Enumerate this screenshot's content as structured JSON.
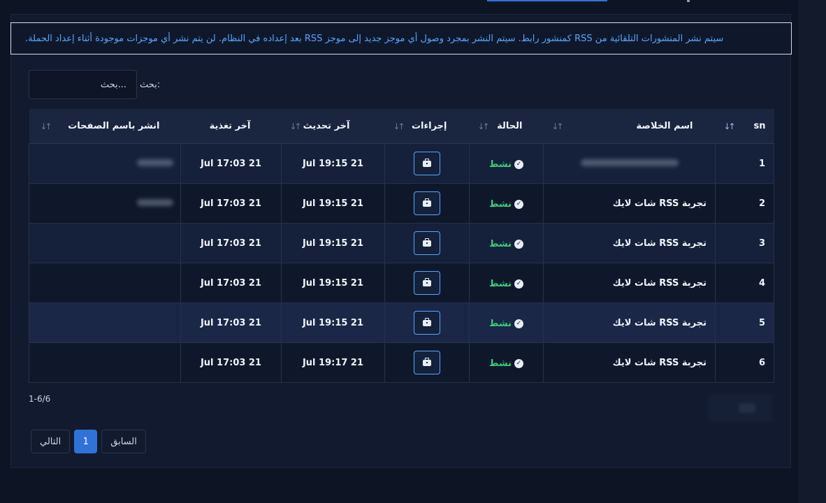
{
  "notice": "سيتم نشر المنشورات التلقائية من RSS كمنشور رابط. سيتم النشر بمجرد وصول أي موجز جديد إلى موجز RSS بعد إعداده في النظام. لن يتم نشر أي موجزات موجودة أثناء إعداد الحملة.",
  "search": {
    "label": "بحث:",
    "placeholder": "بحث..."
  },
  "table": {
    "headers": {
      "sn": "sn",
      "feed_name": "اسم الخلاصة",
      "status": "الحالة",
      "actions": "إجراءات",
      "last_update": "آخر تحديث",
      "last_feed": "آخر تغذية",
      "publish_as": "انشر باسم الصفحات"
    },
    "rows": [
      {
        "sn": "1",
        "feed_name": "",
        "status": "نشط",
        "last_update": "Jul 19:15 21",
        "last_feed": "Jul 17:03 21",
        "publish_as": ""
      },
      {
        "sn": "2",
        "feed_name": "تجربة RSS شات لايك",
        "status": "نشط",
        "last_update": "Jul 19:15 21",
        "last_feed": "Jul 17:03 21",
        "publish_as": ""
      },
      {
        "sn": "3",
        "feed_name": "تجربة RSS شات لايك",
        "status": "نشط",
        "last_update": "Jul 19:15 21",
        "last_feed": "Jul 17:03 21",
        "publish_as": ""
      },
      {
        "sn": "4",
        "feed_name": "تجربة RSS شات لايك",
        "status": "نشط",
        "last_update": "Jul 19:15 21",
        "last_feed": "Jul 17:03 21",
        "publish_as": ""
      },
      {
        "sn": "5",
        "feed_name": "تجربة RSS شات لايك",
        "status": "نشط",
        "last_update": "Jul 19:15 21",
        "last_feed": "Jul 17:03 21",
        "publish_as": ""
      },
      {
        "sn": "6",
        "feed_name": "تجربة RSS شات لايك",
        "status": "نشط",
        "last_update": "Jul 19:17 21",
        "last_feed": "Jul 17:03 21",
        "publish_as": ""
      }
    ]
  },
  "pagination": {
    "range": "1-6/6",
    "prev": "السابق",
    "current": "1",
    "next": "التالي"
  },
  "colors": {
    "accent": "#2f73d9",
    "status_active": "#36d27a",
    "notice_text": "#58a6ff"
  },
  "icons": {
    "status": "check-circle-icon",
    "action": "briefcase-icon",
    "sort": "sort-arrows-icon"
  }
}
